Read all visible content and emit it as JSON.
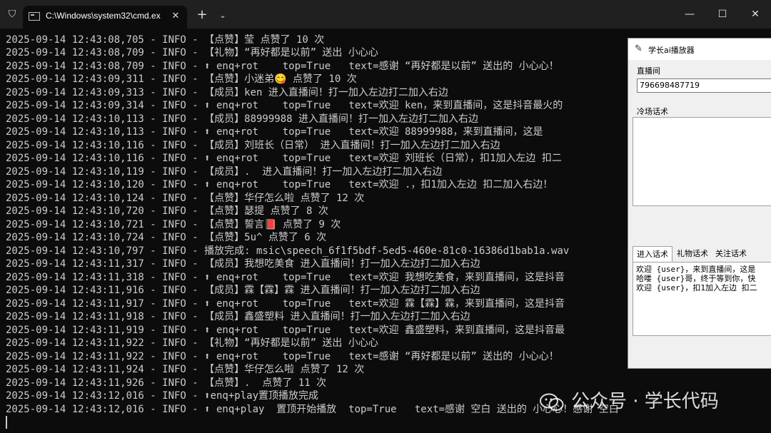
{
  "window": {
    "tab_title": "C:\\Windows\\system32\\cmd.ex",
    "close_tab": "✕",
    "new_tab": "+",
    "dropdown": "⌄",
    "minimize": "—",
    "maximize": "☐",
    "close": "✕"
  },
  "console_lines": [
    "2025-09-14 12:43:08,705 - INFO - 【点赞】莹 点赞了 10 次",
    "2025-09-14 12:43:08,709 - INFO - 【礼物】“再好都是以前” 送出 小心心",
    "2025-09-14 12:43:08,709 - INFO - ⬆ enq+rot    top=True   text=感谢 “再好都是以前” 送出的 小心心！",
    "2025-09-14 12:43:09,311 - INFO - 【点赞】小迷弟😋 点赞了 10 次",
    "2025-09-14 12:43:09,313 - INFO - 【成员】ken 进入直播间！打一加入左边打二加入右边",
    "2025-09-14 12:43:09,314 - INFO - ⬆ enq+rot    top=True   text=欢迎 ken，来到直播间，这是抖音最火的",
    "2025-09-14 12:43:10,113 - INFO - 【成员】88999988 进入直播间！打一加入左边打二加入右边",
    "2025-09-14 12:43:10,113 - INFO - ⬆ enq+rot    top=True   text=欢迎 88999988，来到直播间，这是",
    "2025-09-14 12:43:10,116 - INFO - 【成员】刘班长（日常） 进入直播间！打一加入左边打二加入右边",
    "2025-09-14 12:43:10,116 - INFO - ⬆ enq+rot    top=True   text=欢迎 刘班长（日常），扣1加入左边 扣二",
    "2025-09-14 12:43:10,119 - INFO - 【成员】.  进入直播间！打一加入左边打二加入右边",
    "2025-09-14 12:43:10,120 - INFO - ⬆ enq+rot    top=True   text=欢迎 .，扣1加入左边 扣二加入右边！",
    "2025-09-14 12:43:10,124 - INFO - 【点赞】华仔怎么啦 点赞了 12 次",
    "2025-09-14 12:43:10,720 - INFO - 【点赞】瑟提 点赞了 8 次",
    "2025-09-14 12:43:10,721 - INFO - 【点赞】誓言📕 点赞了 9 次",
    "2025-09-14 12:43:10,724 - INFO - 【点赞】5u^ 点赞了 6 次",
    "2025-09-14 12:43:10,797 - INFO - 播放完成: msic\\speech_6f1f5bdf-5ed5-460e-81c0-16386d1bab1a.wav",
    "2025-09-14 12:43:11,317 - INFO - 【成员】我想吃美食 进入直播间！打一加入左边打二加入右边",
    "2025-09-14 12:43:11,318 - INFO - ⬆ enq+rot    top=True   text=欢迎 我想吃美食，来到直播间，这是抖音",
    "2025-09-14 12:43:11,916 - INFO - 【成员】霖【霖】霖 进入直播间！打一加入左边打二加入右边",
    "2025-09-14 12:43:11,917 - INFO - ⬆ enq+rot    top=True   text=欢迎 霖【霖】霖，来到直播间，这是抖音",
    "2025-09-14 12:43:11,918 - INFO - 【成员】鑫盛塑料 进入直播间！打一加入左边打二加入右边",
    "2025-09-14 12:43:11,919 - INFO - ⬆ enq+rot    top=True   text=欢迎 鑫盛塑料，来到直播间，这是抖音最",
    "2025-09-14 12:43:11,922 - INFO - 【礼物】“再好都是以前” 送出 小心心",
    "2025-09-14 12:43:11,922 - INFO - ⬆ enq+rot    top=True   text=感谢 “再好都是以前” 送出的 小心心！",
    "2025-09-14 12:43:11,924 - INFO - 【点赞】华仔怎么啦 点赞了 12 次",
    "2025-09-14 12:43:11,926 - INFO - 【点赞】.  点赞了 11 次",
    "2025-09-14 12:43:12,016 - INFO - ⬆enq+play置顶播放完成",
    "2025-09-14 12:43:12,016 - INFO - ⬆ enq+play  置顶开始播放  top=True   text=感谢 空白 送出的 小心心！感谢 空白"
  ],
  "app": {
    "title": "学长ai播放器",
    "room_label": "直播间",
    "room_value": "796698487719",
    "cold_label": "冷场话术",
    "tabs": [
      "进入话术",
      "礼物话术",
      "关注话术"
    ],
    "phrases": [
      "欢迎 {user}，来到直播间，这是",
      "哈喽 {user}哥，终于等到你，快",
      "欢迎 {user}，扣1加入左边 扣二"
    ]
  },
  "watermark": {
    "text": "公众号 · 学长代码"
  }
}
